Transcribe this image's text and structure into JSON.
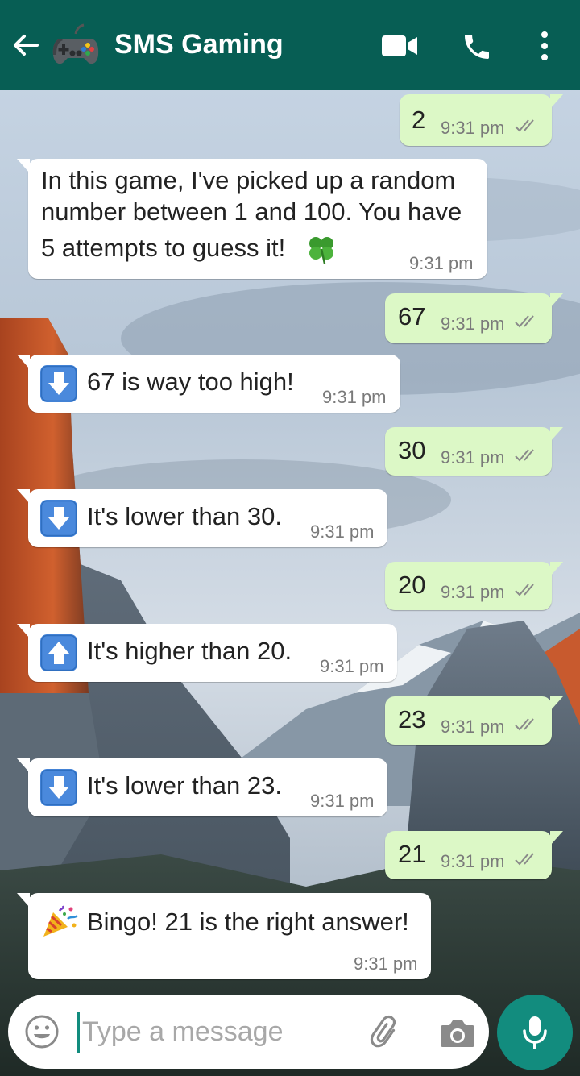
{
  "header": {
    "title": "SMS Gaming"
  },
  "messages": [
    {
      "direction": "out",
      "text": "2",
      "time": "9:31 pm",
      "status": "read"
    },
    {
      "direction": "in",
      "lines": [
        "In this game, I've picked up a random",
        "number between 1 and 100. You have",
        "5 attempts to guess it!"
      ],
      "emoji": "four-leaf-clover",
      "time": "9:31 pm"
    },
    {
      "direction": "out",
      "text": "67",
      "time": "9:31 pm",
      "status": "read"
    },
    {
      "direction": "in",
      "icon": "arrow-down",
      "text": "67 is way too high!",
      "time": "9:31 pm"
    },
    {
      "direction": "out",
      "text": "30",
      "time": "9:31 pm",
      "status": "read"
    },
    {
      "direction": "in",
      "icon": "arrow-down",
      "text": "It's lower than 30.",
      "time": "9:31 pm"
    },
    {
      "direction": "out",
      "text": "20",
      "time": "9:31 pm",
      "status": "read"
    },
    {
      "direction": "in",
      "icon": "arrow-up",
      "text": "It's higher than 20.",
      "time": "9:31 pm"
    },
    {
      "direction": "out",
      "text": "23",
      "time": "9:31 pm",
      "status": "read"
    },
    {
      "direction": "in",
      "icon": "arrow-down",
      "text": "It's lower than 23.",
      "time": "9:31 pm"
    },
    {
      "direction": "out",
      "text": "21",
      "time": "9:31 pm",
      "status": "read"
    },
    {
      "direction": "in",
      "icon": "party-popper",
      "text": "Bingo! 21 is the right answer!",
      "time": "9:31 pm"
    }
  ],
  "composer": {
    "placeholder": "Type a message"
  },
  "colors": {
    "header": "#075e54",
    "outgoing_bubble": "#dcf8c6",
    "incoming_bubble": "#ffffff",
    "accent": "#128c7e",
    "read_ticks": "#8a8a8a",
    "arrow_icon": "#4a89dc"
  }
}
